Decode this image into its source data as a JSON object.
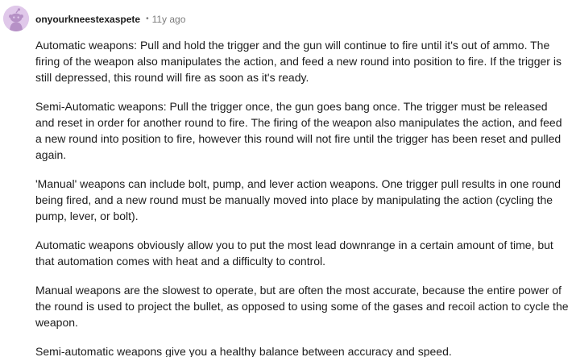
{
  "comment": {
    "author": "onyourkneestexaspete",
    "separator": "•",
    "timestamp": "11y ago",
    "avatar_icon": "snoo-avatar-icon",
    "avatar_color": "#e0c8ea",
    "paragraphs": [
      "Automatic weapons: Pull and hold the trigger and the gun will continue to fire until it's out of ammo. The firing of the weapon also manipulates the action, and feed a new round into position to fire. If the trigger is still depressed, this round will fire as soon as it's ready.",
      "Semi-Automatic weapons: Pull the trigger once, the gun goes bang once. The trigger must be released and reset in order for another round to fire. The firing of the weapon also manipulates the action, and feed a new round into position to fire, however this round will not fire until the trigger has been reset and pulled again.",
      "'Manual' weapons can include bolt, pump, and lever action weapons. One trigger pull results in one round being fired, and a new round must be manually moved into place by manipulating the action (cycling the pump, lever, or bolt).",
      "Automatic weapons obviously allow you to put the most lead downrange in a certain amount of time, but that automation comes with heat and a difficulty to control.",
      "Manual weapons are the slowest to operate, but are often the most accurate, because the entire power of the round is used to project the bullet, as opposed to using some of the gases and recoil action to cycle the weapon.",
      "Semi-automatic weapons give you a healthy balance between accuracy and speed."
    ]
  }
}
